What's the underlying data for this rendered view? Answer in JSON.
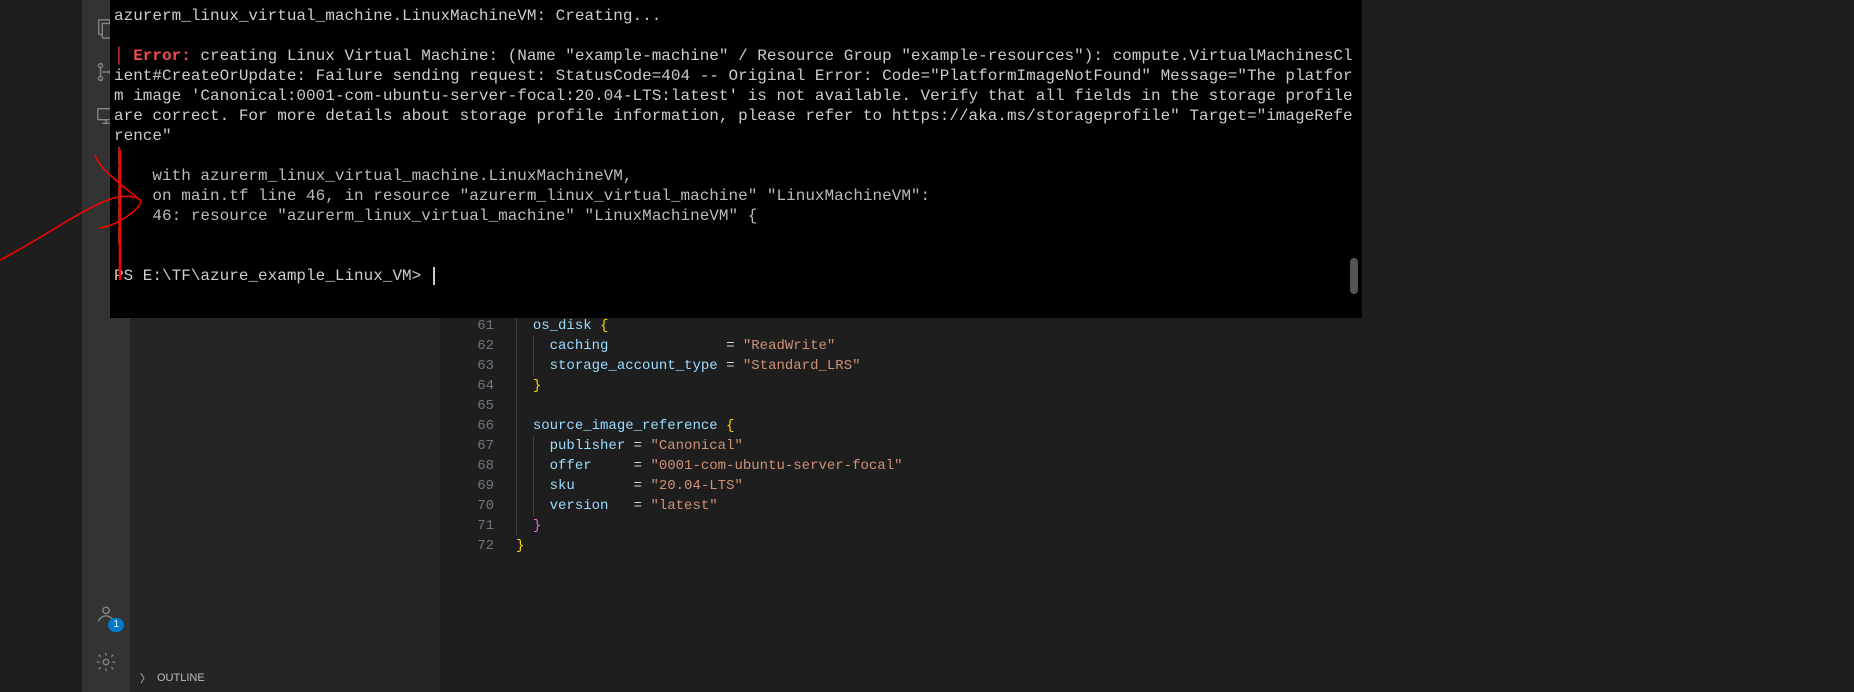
{
  "activity_bar": {
    "icons": [
      "explorer-icon",
      "source-control-icon",
      "remote-icon",
      "accounts-icon",
      "settings-gear-icon"
    ],
    "accounts_badge": "1"
  },
  "sidebar": {
    "outline_label": "OUTLINE"
  },
  "terminal": {
    "creating_line": "azurerm_linux_virtual_machine.LinuxMachineVM: Creating...",
    "error_label": "Error:",
    "error_text": " creating Linux Virtual Machine: (Name \"example-machine\" / Resource Group \"example-resources\"): compute.VirtualMachinesClient#CreateOrUpdate: Failure sending request: StatusCode=404 -- Original Error: Code=\"PlatformImageNotFound\" Message=\"The platform image 'Canonical:0001-com-ubuntu-server-focal:20.04-LTS:latest' is not available. Verify that all fields in the storage profile are correct. For more details about storage profile information, please refer to https://aka.ms/storageprofile\" Target=\"imageReference\"",
    "context": [
      "with azurerm_linux_virtual_machine.LinuxMachineVM,",
      "on main.tf line 46, in resource \"azurerm_linux_virtual_machine\" \"LinuxMachineVM\":",
      "46: resource \"azurerm_linux_virtual_machine\" \"LinuxMachineVM\" {"
    ],
    "prompt": "PS E:\\TF\\azure_example_Linux_VM> "
  },
  "editor": {
    "lines": [
      {
        "num": "61",
        "indent": 1,
        "tokens": [
          [
            "os_disk ",
            "prop"
          ],
          [
            "{",
            "brace"
          ]
        ]
      },
      {
        "num": "62",
        "indent": 2,
        "tokens": [
          [
            "caching              ",
            "prop"
          ],
          [
            "= ",
            "punc"
          ],
          [
            "\"ReadWrite\"",
            "str"
          ]
        ]
      },
      {
        "num": "63",
        "indent": 2,
        "tokens": [
          [
            "storage_account_type ",
            "prop"
          ],
          [
            "= ",
            "punc"
          ],
          [
            "\"Standard_LRS\"",
            "str"
          ]
        ]
      },
      {
        "num": "64",
        "indent": 1,
        "tokens": [
          [
            "}",
            "brace"
          ]
        ]
      },
      {
        "num": "65",
        "indent": 1,
        "tokens": []
      },
      {
        "num": "66",
        "indent": 1,
        "tokens": [
          [
            "source_image_reference ",
            "prop"
          ],
          [
            "{",
            "brace"
          ]
        ]
      },
      {
        "num": "67",
        "indent": 2,
        "tokens": [
          [
            "publisher ",
            "prop"
          ],
          [
            "= ",
            "punc"
          ],
          [
            "\"Canonical\"",
            "str"
          ]
        ]
      },
      {
        "num": "68",
        "indent": 2,
        "tokens": [
          [
            "offer     ",
            "prop"
          ],
          [
            "= ",
            "punc"
          ],
          [
            "\"0001-com-ubuntu-server-focal\"",
            "str"
          ]
        ],
        "highlight": true
      },
      {
        "num": "69",
        "indent": 2,
        "tokens": [
          [
            "sku       ",
            "prop"
          ],
          [
            "= ",
            "punc"
          ],
          [
            "\"20.04-LTS\"",
            "str"
          ]
        ]
      },
      {
        "num": "70",
        "indent": 2,
        "tokens": [
          [
            "version   ",
            "prop"
          ],
          [
            "= ",
            "punc"
          ],
          [
            "\"latest\"",
            "str"
          ]
        ]
      },
      {
        "num": "71",
        "indent": 1,
        "tokens": [
          [
            "}",
            "brace-p"
          ]
        ]
      },
      {
        "num": "72",
        "indent": 0,
        "tokens": [
          [
            "}",
            "brace"
          ]
        ]
      }
    ]
  }
}
